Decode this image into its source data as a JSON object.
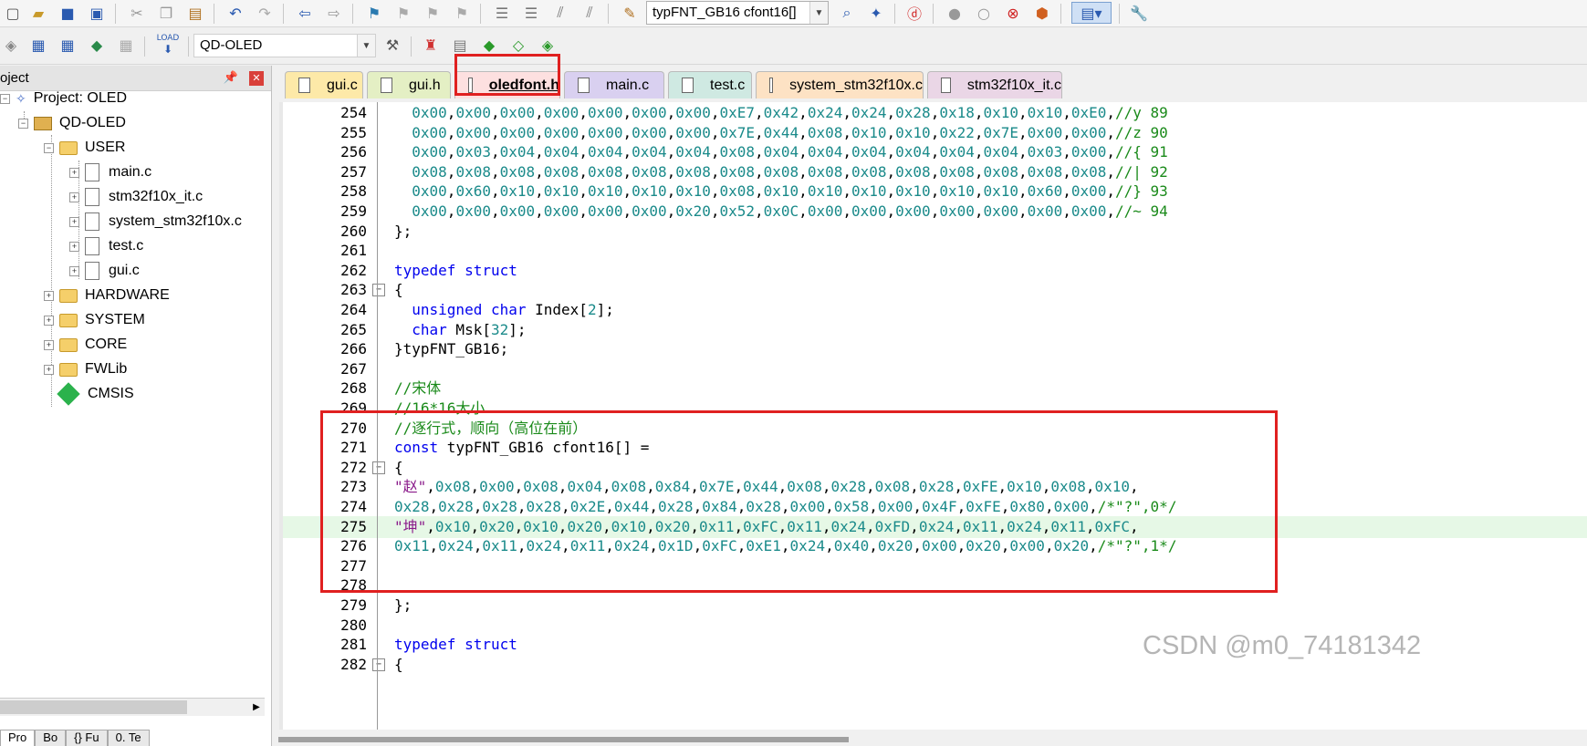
{
  "toolbar1": {
    "target_combo": "typFNT_GB16 cfont16[]"
  },
  "toolbar2": {
    "target_select": "QD-OLED",
    "load_label": "LOAD"
  },
  "project_panel": {
    "title": "oject",
    "tree": [
      {
        "label": "Project: OLED"
      },
      {
        "label": "QD-OLED"
      },
      {
        "label": "USER"
      },
      {
        "label": "main.c"
      },
      {
        "label": "stm32f10x_it.c"
      },
      {
        "label": "system_stm32f10x.c"
      },
      {
        "label": "test.c"
      },
      {
        "label": "gui.c"
      },
      {
        "label": "HARDWARE"
      },
      {
        "label": "SYSTEM"
      },
      {
        "label": "CORE"
      },
      {
        "label": "FWLib"
      },
      {
        "label": "CMSIS"
      }
    ],
    "bottom_tabs": [
      "Pro",
      "Bo",
      "{} Fu",
      "0. Te"
    ]
  },
  "editor": {
    "tabs": [
      {
        "label": "gui.c",
        "color": "#fde9a8"
      },
      {
        "label": "gui.h",
        "color": "#e4efc4"
      },
      {
        "label": "oledfont.h",
        "color": "#fde0e0"
      },
      {
        "label": "main.c",
        "color": "#d9d0f0"
      },
      {
        "label": "test.c",
        "color": "#cfe9e2"
      },
      {
        "label": "system_stm32f10x.c",
        "color": "#fde2c4"
      },
      {
        "label": "stm32f10x_it.c",
        "color": "#ead6e6"
      }
    ],
    "active_tab": "oledfont.h",
    "lines": [
      {
        "n": "254",
        "t": "  0x00,0x00,0x00,0x00,0x00,0x00,0x00,0xE7,0x42,0x24,0x24,0x28,0x18,0x10,0x10,0xE0,//y 89"
      },
      {
        "n": "255",
        "t": "  0x00,0x00,0x00,0x00,0x00,0x00,0x00,0x7E,0x44,0x08,0x10,0x10,0x22,0x7E,0x00,0x00,//z 90"
      },
      {
        "n": "256",
        "t": "  0x00,0x03,0x04,0x04,0x04,0x04,0x04,0x08,0x04,0x04,0x04,0x04,0x04,0x04,0x03,0x00,//{ 91"
      },
      {
        "n": "257",
        "t": "  0x08,0x08,0x08,0x08,0x08,0x08,0x08,0x08,0x08,0x08,0x08,0x08,0x08,0x08,0x08,0x08,//| 92"
      },
      {
        "n": "258",
        "t": "  0x00,0x60,0x10,0x10,0x10,0x10,0x10,0x08,0x10,0x10,0x10,0x10,0x10,0x10,0x60,0x00,//} 93"
      },
      {
        "n": "259",
        "t": "  0x00,0x00,0x00,0x00,0x00,0x00,0x20,0x52,0x0C,0x00,0x00,0x00,0x00,0x00,0x00,0x00,//~ 94"
      },
      {
        "n": "260",
        "t": "};"
      },
      {
        "n": "261",
        "t": ""
      },
      {
        "n": "262",
        "t": "typedef struct"
      },
      {
        "n": "263",
        "t": "{"
      },
      {
        "n": "264",
        "t": "  unsigned char Index[2];"
      },
      {
        "n": "265",
        "t": "  char Msk[32];"
      },
      {
        "n": "266",
        "t": "}typFNT_GB16;"
      },
      {
        "n": "267",
        "t": ""
      },
      {
        "n": "268",
        "t": "//宋体"
      },
      {
        "n": "269",
        "t": "//16*16大小"
      },
      {
        "n": "270",
        "t": "//逐行式，顺向（高位在前）"
      },
      {
        "n": "271",
        "t": "const typFNT_GB16 cfont16[] ="
      },
      {
        "n": "272",
        "t": "{"
      },
      {
        "n": "273",
        "t": "\"赵\",0x08,0x00,0x08,0x04,0x08,0x84,0x7E,0x44,0x08,0x28,0x08,0x28,0xFE,0x10,0x08,0x10,"
      },
      {
        "n": "274",
        "t": "0x28,0x28,0x28,0x28,0x2E,0x44,0x28,0x84,0x28,0x00,0x58,0x00,0x4F,0xFE,0x80,0x00,/*\"?\",0*/"
      },
      {
        "n": "275",
        "t": "\"坤\",0x10,0x20,0x10,0x20,0x10,0x20,0x11,0xFC,0x11,0x24,0xFD,0x24,0x11,0x24,0x11,0xFC,"
      },
      {
        "n": "276",
        "t": "0x11,0x24,0x11,0x24,0x11,0x24,0x1D,0xFC,0xE1,0x24,0x40,0x20,0x00,0x20,0x00,0x20,/*\"?\",1*/"
      },
      {
        "n": "277",
        "t": ""
      },
      {
        "n": "278",
        "t": ""
      },
      {
        "n": "279",
        "t": "};"
      },
      {
        "n": "280",
        "t": ""
      },
      {
        "n": "281",
        "t": "typedef struct"
      },
      {
        "n": "282",
        "t": "{"
      }
    ]
  },
  "watermark": "CSDN @m0_74181342"
}
